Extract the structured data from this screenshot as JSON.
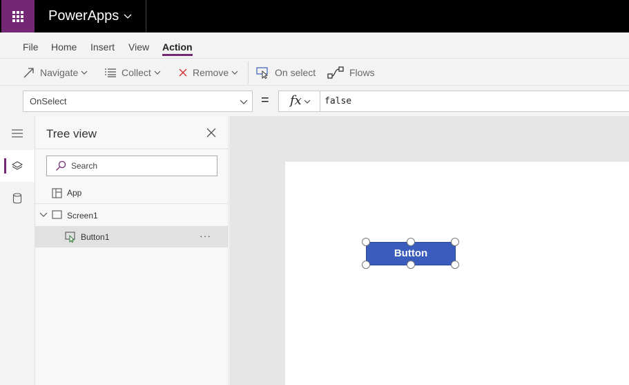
{
  "app": {
    "title": "PowerApps"
  },
  "menu": {
    "tabs": [
      "File",
      "Home",
      "Insert",
      "View",
      "Action"
    ],
    "active": "Action"
  },
  "ribbon": {
    "navigate": "Navigate",
    "collect": "Collect",
    "remove": "Remove",
    "on_select": "On select",
    "flows": "Flows"
  },
  "formula": {
    "property": "OnSelect",
    "equals": "=",
    "fx": "fx",
    "value": "false"
  },
  "tree": {
    "title": "Tree view",
    "search_placeholder": "Search",
    "app_label": "App",
    "screen_label": "Screen1",
    "button_label": "Button1",
    "more": "···"
  },
  "canvas": {
    "button_text": "Button"
  },
  "colors": {
    "brand": "#742774",
    "button_fill": "#3a5cbc"
  },
  "icons": [
    "waffle-icon",
    "chevron-down-icon",
    "navigate-arrow-icon",
    "collect-list-icon",
    "remove-x-icon",
    "on-select-cursor-icon",
    "flows-icon",
    "hamburger-icon",
    "layers-icon",
    "database-icon",
    "close-icon",
    "search-icon",
    "app-icon",
    "screen-icon",
    "button-control-icon"
  ]
}
